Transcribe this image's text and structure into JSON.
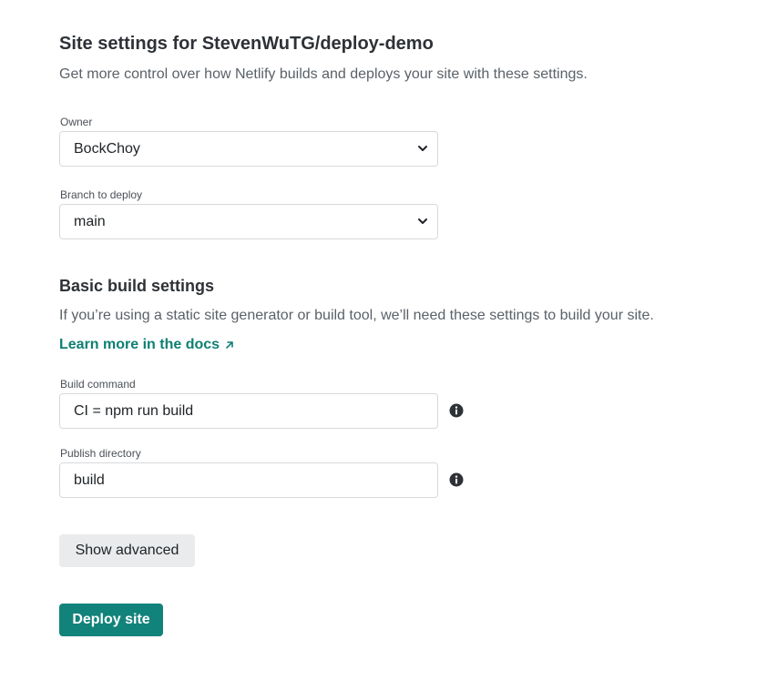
{
  "header": {
    "title": "Site settings for StevenWuTG/deploy-demo",
    "subtitle": "Get more control over how Netlify builds and deploys your site with these settings."
  },
  "owner": {
    "label": "Owner",
    "value": "BockChoy"
  },
  "branch": {
    "label": "Branch to deploy",
    "value": "main"
  },
  "build_settings": {
    "title": "Basic build settings",
    "description": "If you’re using a static site generator or build tool, we’ll need these settings to build your site.",
    "docs_link": "Learn more in the docs"
  },
  "build_command": {
    "label": "Build command",
    "value": "CI = npm run build"
  },
  "publish_directory": {
    "label": "Publish directory",
    "value": "build"
  },
  "buttons": {
    "show_advanced": "Show advanced",
    "deploy": "Deploy site"
  },
  "colors": {
    "accent": "#12837a",
    "link": "#0e7f73",
    "secondary_button": "#e9ebed"
  },
  "icons": {
    "dropdown": "chevron-down-icon",
    "external": "external-arrow-icon",
    "info": "info-icon"
  }
}
